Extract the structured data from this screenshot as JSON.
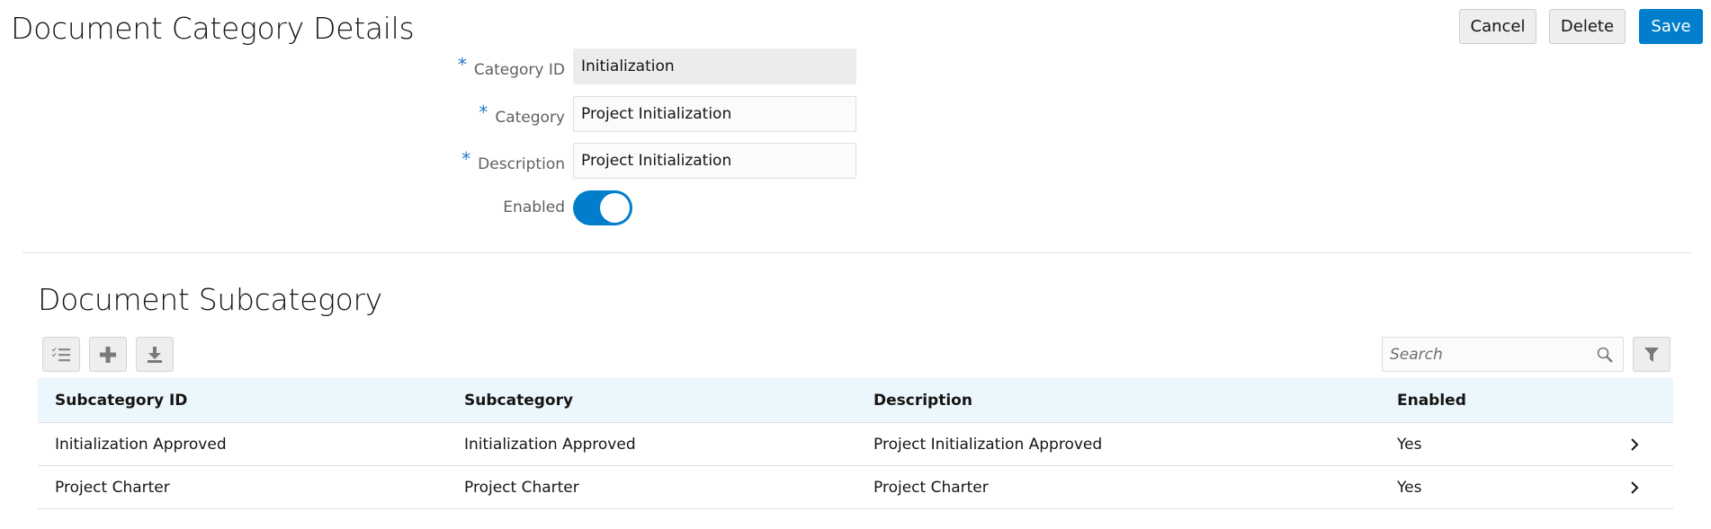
{
  "header": {
    "title": "Document Category Details",
    "buttons": {
      "cancel": "Cancel",
      "delete": "Delete",
      "save": "Save"
    }
  },
  "form": {
    "required_marker": "*",
    "category_id": {
      "label": "Category ID",
      "value": "Initialization",
      "required": true,
      "readonly": true
    },
    "category": {
      "label": "Category",
      "value": "Project Initialization",
      "required": true
    },
    "description": {
      "label": "Description",
      "value": "Project Initialization",
      "required": true
    },
    "enabled": {
      "label": "Enabled",
      "value": true
    }
  },
  "subcategory": {
    "title": "Document Subcategory",
    "toolbar": {
      "icons": [
        "checklist-icon",
        "plus-icon",
        "download-icon"
      ]
    },
    "search": {
      "placeholder": "Search",
      "value": ""
    },
    "filter_icon": "filter-icon",
    "table": {
      "columns": [
        "Subcategory ID",
        "Subcategory",
        "Description",
        "Enabled"
      ],
      "rows": [
        [
          "Initialization Approved",
          "Initialization Approved",
          "Project Initialization Approved",
          "Yes"
        ],
        [
          "Project Charter",
          "Project Charter",
          "Project Charter",
          "Yes"
        ]
      ]
    }
  },
  "colors": {
    "accent": "#007ecc",
    "header_bg": "#ebf6fd",
    "required": "#227bc7"
  }
}
